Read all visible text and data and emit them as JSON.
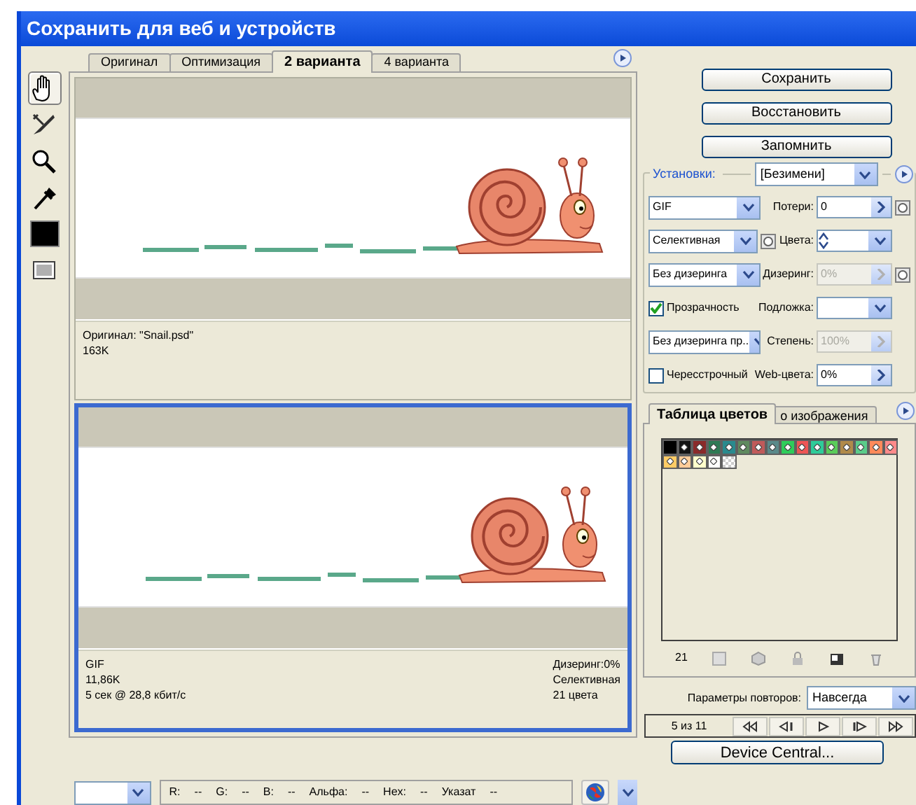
{
  "window": {
    "title": "Сохранить для веб и устройств"
  },
  "tools": [
    {
      "kind": "hand",
      "selected": true
    },
    {
      "kind": "slice",
      "selected": false
    },
    {
      "kind": "zoom",
      "selected": false
    },
    {
      "kind": "eyedropper",
      "selected": false
    },
    {
      "kind": "color",
      "selected": false
    },
    {
      "kind": "slices-toggle",
      "selected": false
    }
  ],
  "tabs": [
    {
      "label": "Оригинал",
      "selected": false
    },
    {
      "label": "Оптимизация",
      "selected": false
    },
    {
      "label": "2 варианта",
      "selected": true
    },
    {
      "label": "4 варианта",
      "selected": false
    }
  ],
  "previews": [
    {
      "selected": false,
      "info_left": [
        "Оригинал: \"Snail.psd\"",
        "163K"
      ]
    },
    {
      "selected": true,
      "info_left": [
        "GIF",
        "11,86K",
        "5 сек @ 28,8 кбит/с"
      ],
      "info_right": [
        "Дизеринг:0%",
        "Селективная",
        "21 цвета"
      ]
    }
  ],
  "buttons": [
    "Сохранить",
    "Восстановить",
    "Запомнить"
  ],
  "settings": {
    "label": "Установки:",
    "preset": "[Безимени]",
    "rows": [
      {
        "left": {
          "kind": "select",
          "value": "GIF"
        },
        "right": {
          "label": "Потери:",
          "kind": "stepper-mask",
          "value": "0",
          "disabled": false
        }
      },
      {
        "left": {
          "kind": "select-mask",
          "value": "Селективная"
        },
        "right": {
          "label": "Цвета:",
          "kind": "spin-combo",
          "disabled": false
        }
      },
      {
        "left": {
          "kind": "select",
          "value": "Без дизеринга"
        },
        "right": {
          "label": "Дизеринг:",
          "kind": "stepper-mask",
          "value": "0%",
          "disabled": true
        }
      },
      {
        "left": {
          "kind": "checkbox",
          "value": "Прозрачность",
          "checked": true
        },
        "right": {
          "label": "Подложка:",
          "kind": "combo",
          "disabled": false
        }
      },
      {
        "left": {
          "kind": "select",
          "value": "Без дизеринга пр.."
        },
        "right": {
          "label": "Степень:",
          "kind": "stepper",
          "value": "100%",
          "disabled": true
        }
      },
      {
        "left": {
          "kind": "checkbox",
          "value": "Чересстрочный",
          "checked": false
        },
        "right": {
          "label": "Web-цвета:",
          "kind": "stepper",
          "value": "0%",
          "disabled": false
        }
      }
    ]
  },
  "color_table": {
    "tabs": [
      {
        "label": "Таблица цветов",
        "selected": true
      },
      {
        "label": "о изображения",
        "selected": false
      }
    ],
    "swatches": [
      {
        "color": "#000000",
        "selected": true
      },
      {
        "color": "#141414",
        "selected": false
      },
      {
        "color": "#8a2a2a",
        "selected": false
      },
      {
        "color": "#2e7a55",
        "selected": false
      },
      {
        "color": "#2a8a8e",
        "selected": false
      },
      {
        "color": "#5f8a5f",
        "selected": false
      },
      {
        "color": "#c05a5a",
        "selected": false
      },
      {
        "color": "#5a8a8a",
        "selected": false
      },
      {
        "color": "#2ecc5a",
        "selected": false
      },
      {
        "color": "#ee5555",
        "selected": false
      },
      {
        "color": "#2ecc99",
        "selected": false
      },
      {
        "color": "#5acc5a",
        "selected": false
      },
      {
        "color": "#b08a4a",
        "selected": false
      },
      {
        "color": "#5acc8a",
        "selected": false
      },
      {
        "color": "#ff8a5a",
        "selected": false
      },
      {
        "color": "#ff8a8a",
        "selected": false
      },
      {
        "color": "#ffcc66",
        "selected": false
      },
      {
        "color": "#ffcc99",
        "selected": false
      },
      {
        "color": "#ffffcc",
        "selected": false
      },
      {
        "color": "#ffffff",
        "selected": false
      },
      {
        "color": "#cccccc",
        "kind": "transparent",
        "selected": false
      }
    ],
    "count": "21"
  },
  "loop": {
    "label": "Параметры повторов:",
    "value": "Навсегда"
  },
  "animation": {
    "counter": "5 из 11"
  },
  "device_button": "Device Central...",
  "status_bar": {
    "readouts": [
      {
        "label": "R:",
        "value": "--"
      },
      {
        "label": "G:",
        "value": "--"
      },
      {
        "label": "B:",
        "value": "--"
      },
      {
        "label": "Альфа:",
        "value": "--"
      },
      {
        "label": "Hex:",
        "value": "--"
      },
      {
        "label": "Указат",
        "value": "--"
      }
    ]
  }
}
